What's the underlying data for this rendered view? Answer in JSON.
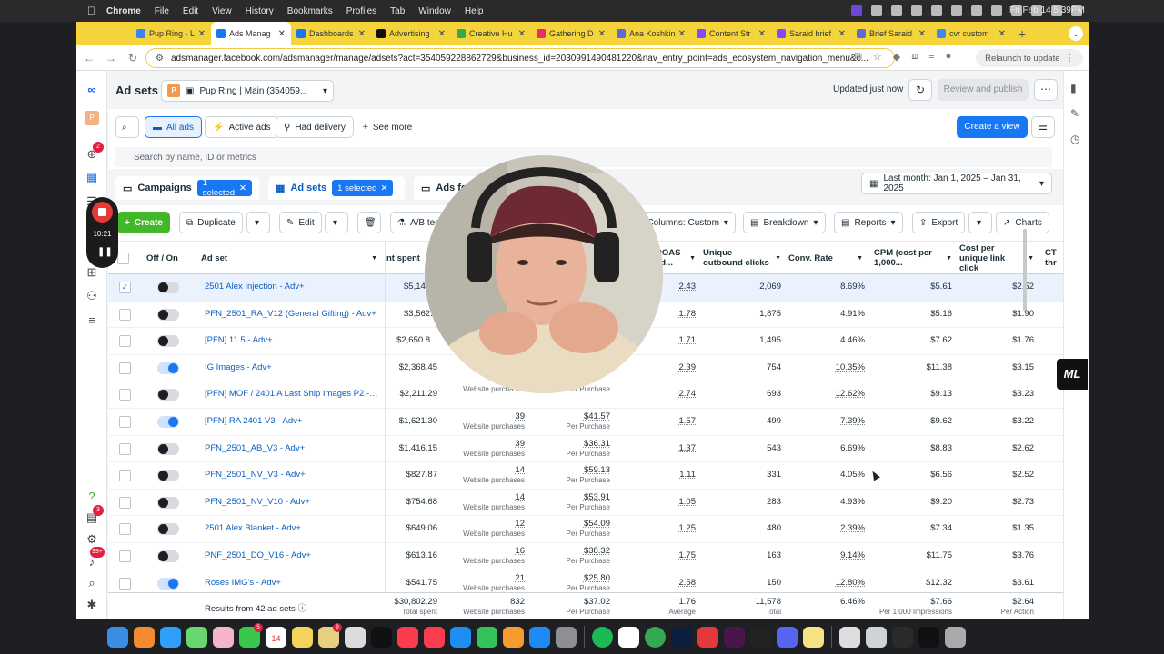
{
  "menubar": {
    "app": "Chrome",
    "items": [
      "File",
      "Edit",
      "View",
      "History",
      "Bookmarks",
      "Profiles",
      "Tab",
      "Window",
      "Help"
    ],
    "clock": "Fri Feb 14  5:39PM"
  },
  "tabs": [
    {
      "label": "Pup Ring - L",
      "color": "#3b82f6"
    },
    {
      "label": "Ads Manag",
      "color": "#1877f2",
      "active": true
    },
    {
      "label": "Dashboards",
      "color": "#1877f2"
    },
    {
      "label": "Advertising",
      "color": "#111111"
    },
    {
      "label": "Creative Hu",
      "color": "#34a853"
    },
    {
      "label": "Gathering D",
      "color": "#e1306c"
    },
    {
      "label": "Ana Koshkin",
      "color": "#5b6bd6"
    },
    {
      "label": "Content Str",
      "color": "#7c4dff"
    },
    {
      "label": "Saraid brief",
      "color": "#7c4dff"
    },
    {
      "label": "Brief Saraid",
      "color": "#5b6bd6"
    },
    {
      "label": "cvr custom",
      "color": "#4285f4"
    }
  ],
  "address": {
    "url": "adsmanager.facebook.com/adsmanager/manage/adsets?act=354059228862729&business_id=2030991490481220&nav_entry_point=ads_ecosystem_navigation_menu&c...",
    "relaunch": "Relaunch to update"
  },
  "header": {
    "title": "Ad sets",
    "account_initial": "P",
    "account": "Pup Ring | Main (354059...",
    "updated": "Updated just now",
    "review": "Review and publish"
  },
  "filters": {
    "all_ads": "All ads",
    "active_ads": "Active ads",
    "had_delivery": "Had delivery",
    "see_more": "See more",
    "create_view": "Create a view",
    "search_placeholder": "Search by name, ID or metrics"
  },
  "levels": {
    "campaigns": "Campaigns",
    "campaigns_sel": "1 selected",
    "adsets": "Ad sets",
    "adsets_sel": "1 selected",
    "ads": "Ads for",
    "date": "Last month: Jan 1, 2025 – Jan 31, 2025"
  },
  "toolbar": {
    "create": "Create",
    "duplicate": "Duplicate",
    "edit": "Edit",
    "ab_test": "A/B test",
    "columns": "Columns: Custom",
    "breakdown": "Breakdown",
    "reports": "Reports",
    "export": "Export",
    "charts": "Charts"
  },
  "recorder": {
    "time": "10:21"
  },
  "table": {
    "headers": {
      "offon": "Off / On",
      "adset": "Ad set",
      "spent": "nt spent",
      "roas": "ROAS ad...",
      "clicks": "Unique outbound clicks",
      "conv": "Conv. Rate",
      "cpm": "CPM (cost per 1,000...",
      "cpu": "Cost per unique link click",
      "ct": "CT thr"
    },
    "rows": [
      {
        "on": false,
        "checked": true,
        "name": "2501 Alex Injection - Adv+",
        "spent": "$5,149...",
        "purch": "",
        "purch_sub": "",
        "cpp": "",
        "cpp_sub": "",
        "roas": "2.43",
        "clicks": "2,069",
        "conv": "8.69%",
        "conv_u": false,
        "cpm": "$5.61",
        "cpu": "$2.52"
      },
      {
        "on": false,
        "checked": false,
        "name": "PFN_2501_RA_V12 (General Gifting) - Adv+",
        "spent": "$3,562...",
        "purch": "",
        "purch_sub": "",
        "cpp": "",
        "cpp_sub": "",
        "roas": "1.78",
        "clicks": "1,875",
        "conv": "4.91%",
        "conv_u": false,
        "cpm": "$5.16",
        "cpu": "$1.90"
      },
      {
        "on": false,
        "checked": false,
        "name": "[PFN] 11.5 - Adv+",
        "spent": "$2,650.8...",
        "purch": "",
        "purch_sub": "",
        "cpp": "",
        "cpp_sub": "",
        "roas": "1.71",
        "clicks": "1,495",
        "conv": "4.46%",
        "conv_u": false,
        "cpm": "$7.62",
        "cpu": "$1.76"
      },
      {
        "on": true,
        "checked": false,
        "name": "IG Images - Adv+",
        "spent": "$2,368.45",
        "purch": "",
        "purch_sub": "",
        "cpp": "",
        "cpp_sub": "",
        "roas": "2.39",
        "clicks": "754",
        "conv": "10.35%",
        "conv_u": true,
        "cpm": "$11.38",
        "cpu": "$3.15"
      },
      {
        "on": false,
        "checked": false,
        "name": "[PFN] MOF / 2401 A Last Ship Images P2 - C...",
        "spent": "$2,211.29",
        "purch": "",
        "purch_sub": "Website purchases",
        "cpp": "",
        "cpp_sub": "Per Purchase",
        "roas": "2.74",
        "clicks": "693",
        "conv": "12.62%",
        "conv_u": true,
        "cpm": "$9.13",
        "cpu": "$3.23"
      },
      {
        "on": true,
        "checked": false,
        "name": "[PFN] RA 2401 V3 - Adv+",
        "spent": "$1,621.30",
        "purch": "39",
        "purch_sub": "Website purchases",
        "cpp": "$41.57",
        "cpp_sub": "Per Purchase",
        "roas": "1.57",
        "clicks": "499",
        "conv": "7.39%",
        "conv_u": true,
        "cpm": "$9.62",
        "cpu": "$3.22"
      },
      {
        "on": false,
        "checked": false,
        "name": "PFN_2501_AB_V3 - Adv+",
        "spent": "$1,416.15",
        "purch": "39",
        "purch_sub": "Website purchases",
        "cpp": "$36.31",
        "cpp_sub": "Per Purchase",
        "roas": "1.37",
        "clicks": "543",
        "conv": "6.69%",
        "conv_u": false,
        "cpm": "$8.83",
        "cpu": "$2.62"
      },
      {
        "on": false,
        "checked": false,
        "name": "PFN_2501_NV_V3 - Adv+",
        "spent": "$827.87",
        "purch": "14",
        "purch_sub": "Website purchases",
        "cpp": "$59.13",
        "cpp_sub": "Per Purchase",
        "roas": "1.11",
        "clicks": "331",
        "conv": "4.05%",
        "conv_u": false,
        "cpm": "$6.56",
        "cpu": "$2.52"
      },
      {
        "on": false,
        "checked": false,
        "name": "PFN_2501_NV_V10 - Adv+",
        "spent": "$754.68",
        "purch": "14",
        "purch_sub": "Website purchases",
        "cpp": "$53.91",
        "cpp_sub": "Per Purchase",
        "roas": "1.05",
        "clicks": "283",
        "conv": "4.93%",
        "conv_u": false,
        "cpm": "$9.20",
        "cpu": "$2.73"
      },
      {
        "on": false,
        "checked": false,
        "name": "2501 Alex Blanket - Adv+",
        "spent": "$649.06",
        "purch": "12",
        "purch_sub": "Website purchases",
        "cpp": "$54.09",
        "cpp_sub": "Per Purchase",
        "roas": "1.25",
        "clicks": "480",
        "conv": "2.39%",
        "conv_u": true,
        "cpm": "$7.34",
        "cpu": "$1.35"
      },
      {
        "on": false,
        "checked": false,
        "name": "PNF_2501_DO_V16 - Adv+",
        "spent": "$613.16",
        "purch": "16",
        "purch_sub": "Website purchases",
        "cpp": "$38.32",
        "cpp_sub": "Per Purchase",
        "roas": "1.75",
        "clicks": "163",
        "conv": "9.14%",
        "conv_u": true,
        "cpm": "$11.75",
        "cpu": "$3.76"
      },
      {
        "on": true,
        "checked": false,
        "name": "Roses IMG's - Adv+",
        "spent": "$541.75",
        "purch": "21",
        "purch_sub": "Website purchases",
        "cpp": "$25.80",
        "cpp_sub": "Per Purchase",
        "roas": "2.58",
        "clicks": "150",
        "conv": "12.80%",
        "conv_u": true,
        "cpm": "$12.32",
        "cpu": "$3.61"
      }
    ],
    "totals": {
      "label": "Results from 42 ad sets",
      "spent": "$30,802.29",
      "spent_sub": "Total spent",
      "purch": "832",
      "purch_sub": "Website purchases",
      "cpp": "$37.02",
      "cpp_sub": "Per Purchase",
      "roas": "1.76",
      "roas_sub": "Average",
      "clicks": "11,578",
      "clicks_sub": "Total",
      "conv": "6.46%",
      "cpm": "$7.66",
      "cpm_sub": "Per 1,000 Impressions",
      "cpu": "$2.64",
      "cpu_sub": "Per Action"
    }
  },
  "rail_badges": {
    "notifications": "2",
    "messages": "3",
    "alerts": "99+"
  },
  "dock_badges": {
    "messages": "5",
    "calendar": "14",
    "sticky": "9"
  },
  "overlay": {
    "ml_label": "ML"
  },
  "colors": {
    "accent": "#1877f2",
    "tabbar": "#f5d33a",
    "create": "#42b72a"
  }
}
